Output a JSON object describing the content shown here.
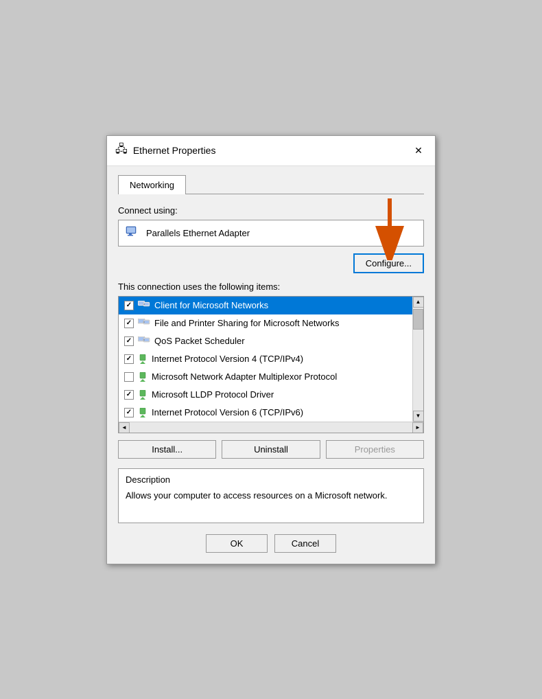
{
  "dialog": {
    "title": "Ethernet Properties",
    "icon": "🖧",
    "close_label": "✕"
  },
  "tabs": [
    {
      "label": "Networking",
      "active": true
    }
  ],
  "connect_using_label": "Connect using:",
  "adapter": {
    "name": "Parallels Ethernet Adapter"
  },
  "configure_button": "Configure...",
  "connection_items_label": "This connection uses the following items:",
  "items": [
    {
      "checked": true,
      "selected": true,
      "icon": "network",
      "label": "Client for Microsoft Networks"
    },
    {
      "checked": true,
      "selected": false,
      "icon": "network",
      "label": "File and Printer Sharing for Microsoft Networks"
    },
    {
      "checked": true,
      "selected": false,
      "icon": "network",
      "label": "QoS Packet Scheduler"
    },
    {
      "checked": true,
      "selected": false,
      "icon": "green",
      "label": "Internet Protocol Version 4 (TCP/IPv4)"
    },
    {
      "checked": false,
      "selected": false,
      "icon": "green",
      "label": "Microsoft Network Adapter Multiplexor Protocol"
    },
    {
      "checked": true,
      "selected": false,
      "icon": "green",
      "label": "Microsoft LLDP Protocol Driver"
    },
    {
      "checked": true,
      "selected": false,
      "icon": "green",
      "label": "Internet Protocol Version 6 (TCP/IPv6)"
    }
  ],
  "buttons": {
    "install": "Install...",
    "uninstall": "Uninstall",
    "properties": "Properties"
  },
  "description": {
    "title": "Description",
    "text": "Allows your computer to access resources on a Microsoft network."
  },
  "footer": {
    "ok": "OK",
    "cancel": "Cancel"
  }
}
